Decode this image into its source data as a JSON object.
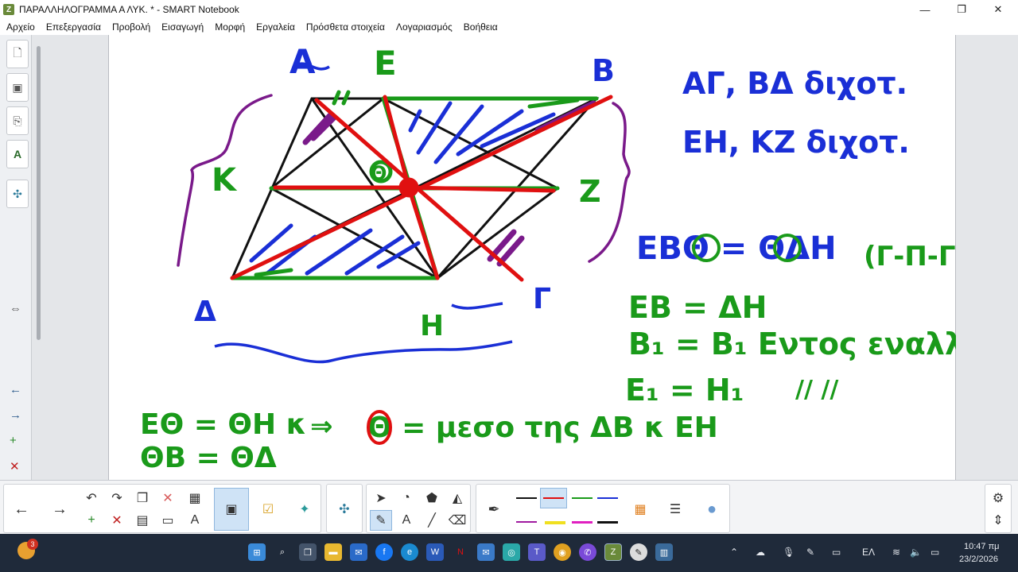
{
  "window": {
    "title": "ΠΑΡΑΛΛΗΛΟΓΡΑΜΜΑ Α ΛΥΚ. * - SMART Notebook",
    "minimize": "—",
    "maximize": "❐",
    "close": "✕"
  },
  "menu": [
    "Αρχείο",
    "Επεξεργασία",
    "Προβολή",
    "Εισαγωγή",
    "Μορφή",
    "Εργαλεία",
    "Πρόσθετα στοιχεία",
    "Λογαριασμός",
    "Βοήθεια"
  ],
  "sidebar": {
    "tabs": [
      {
        "icon": "page-icon",
        "glyph": "🗋"
      },
      {
        "icon": "gallery-icon",
        "glyph": "▣"
      },
      {
        "icon": "attachments-icon",
        "glyph": "⎘"
      },
      {
        "icon": "properties-icon",
        "glyph": "A"
      },
      {
        "icon": "addons-icon",
        "glyph": "✣"
      }
    ],
    "resize_glyph": "⇔",
    "nav_glyphs": [
      "←",
      "→",
      "+",
      "✕"
    ]
  },
  "board": {
    "labels": {
      "A": "A",
      "E": "E",
      "B": "B",
      "K": "K",
      "Z": "Z",
      "D": "Δ",
      "G": "Γ",
      "H": "H",
      "Th": "Θ"
    },
    "notes": {
      "line1": "ΑΓ, ΒΔ διχοτ.",
      "line2": "ΕΗ, ΚΖ διχοτ.",
      "line3": "ΕΒΘ = ΘΔΗ",
      "line3_case": "(Γ-Π-Γ)",
      "line4": "ΕΒ = ΔΗ",
      "line5": "Β₁ = Β₁  Εντος εναλλ",
      "line6": "Ε₁ = Η₁",
      "line6_marks": "//        //",
      "bottom1": "ΕΘ = ΘΗ κ",
      "bottom1_arrow": "⇒",
      "bottom1_rest": "Θ = μεσο  της  ΔΒ  κ  ΕΗ",
      "bottom2": "ΘΒ = ΘΔ"
    }
  },
  "toolbar": {
    "nav_prev": "←",
    "nav_next": "→",
    "undo": "↶",
    "redo": "↷",
    "delete": "✕",
    "table": "▦",
    "select": "➤",
    "text": "A",
    "settings": "⚙",
    "expand": "⇕"
  },
  "taskbar": {
    "badge": "3",
    "lang": "ΕΛ",
    "time": "10:47 πμ",
    "date": "23/2/2026"
  },
  "colors": {
    "blue_ink": "#1a2fd6",
    "green_ink": "#1a9a1a",
    "red_ink": "#e01010",
    "purple_ink": "#7a1a8a",
    "black_ink": "#111111"
  }
}
